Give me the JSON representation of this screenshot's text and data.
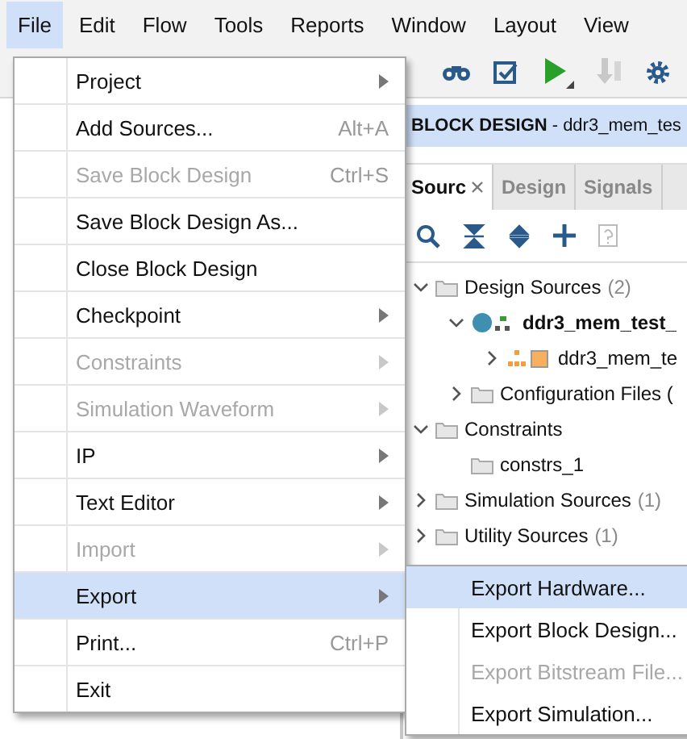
{
  "menubar": [
    {
      "label": "File",
      "selected": true
    },
    {
      "label": "Edit",
      "selected": false
    },
    {
      "label": "Flow",
      "selected": false
    },
    {
      "label": "Tools",
      "selected": false
    },
    {
      "label": "Reports",
      "selected": false
    },
    {
      "label": "Window",
      "selected": false
    },
    {
      "label": "Layout",
      "selected": false
    },
    {
      "label": "View",
      "selected": false
    }
  ],
  "block_design_header": {
    "title": "BLOCK DESIGN",
    "subtitle": "- ddr3_mem_tes"
  },
  "sources_panel": {
    "tabs": [
      {
        "label": "Sourc",
        "selected": true,
        "closable": true
      },
      {
        "label": "Design",
        "selected": false,
        "closable": false
      },
      {
        "label": "Signals",
        "selected": false,
        "closable": false
      }
    ],
    "tree": [
      {
        "label": "Design Sources",
        "count": "(2)",
        "kind": "folder",
        "expanded": true,
        "children": [
          {
            "label": "ddr3_mem_test_",
            "kind": "design",
            "bold": true,
            "expanded": true,
            "children": [
              {
                "label": "ddr3_mem_te",
                "kind": "block",
                "expanded": false
              }
            ]
          },
          {
            "label": "Configuration Files (",
            "kind": "folder",
            "expanded": false
          }
        ]
      },
      {
        "label": "Constraints",
        "kind": "folder",
        "expanded": true,
        "children": [
          {
            "label": "constrs_1",
            "kind": "folder"
          }
        ]
      },
      {
        "label": "Simulation Sources",
        "count": "(1)",
        "kind": "folder",
        "expanded": false
      },
      {
        "label": "Utility Sources",
        "count": "(1)",
        "kind": "folder",
        "expanded": false
      }
    ]
  },
  "file_menu": [
    {
      "label": "Project",
      "submenu": true,
      "disabled": false,
      "selected": false
    },
    {
      "label": "Add Sources...",
      "shortcut": "Alt+A",
      "disabled": false,
      "selected": false
    },
    {
      "label": "Save Block Design",
      "shortcut": "Ctrl+S",
      "disabled": true,
      "selected": false
    },
    {
      "label": "Save Block Design As...",
      "disabled": false,
      "selected": false
    },
    {
      "label": "Close Block Design",
      "disabled": false,
      "selected": false
    },
    {
      "label": "Checkpoint",
      "submenu": true,
      "disabled": false,
      "selected": false
    },
    {
      "label": "Constraints",
      "submenu": true,
      "disabled": true,
      "selected": false
    },
    {
      "label": "Simulation Waveform",
      "submenu": true,
      "disabled": true,
      "selected": false
    },
    {
      "label": "IP",
      "submenu": true,
      "disabled": false,
      "selected": false
    },
    {
      "label": "Text Editor",
      "submenu": true,
      "disabled": false,
      "selected": false
    },
    {
      "label": "Import",
      "submenu": true,
      "disabled": true,
      "selected": false
    },
    {
      "label": "Export",
      "submenu": true,
      "disabled": false,
      "selected": true
    },
    {
      "label": "Print...",
      "shortcut": "Ctrl+P",
      "disabled": false,
      "selected": false
    },
    {
      "label": "Exit",
      "disabled": false,
      "selected": false
    }
  ],
  "export_submenu": [
    {
      "label": "Export Hardware...",
      "disabled": false,
      "selected": true
    },
    {
      "label": "Export Block Design...",
      "disabled": false,
      "selected": false
    },
    {
      "label": "Export Bitstream File...",
      "disabled": true,
      "selected": false
    },
    {
      "label": "Export Simulation...",
      "disabled": false,
      "selected": false
    }
  ]
}
